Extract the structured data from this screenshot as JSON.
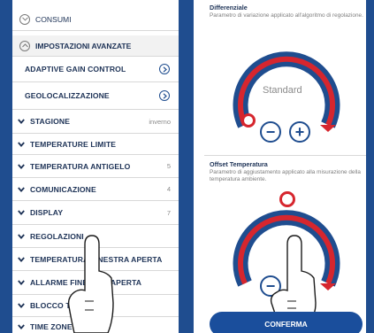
{
  "left": {
    "section_consumi": "CONSUMI",
    "section_advanced": "IMPOSTAZIONI AVANZATE",
    "items": [
      {
        "label": "ADAPTIVE GAIN CONTROL",
        "value": "",
        "kind": "link"
      },
      {
        "label": "GEOLOCALIZZAZIONE",
        "value": "",
        "kind": "link"
      },
      {
        "label": "STAGIONE",
        "value": "inverno",
        "kind": "expand"
      },
      {
        "label": "TEMPERATURE LIMITE",
        "value": "",
        "kind": "expand"
      },
      {
        "label": "TEMPERATURA ANTIGELO",
        "value": "5",
        "kind": "expand"
      },
      {
        "label": "COMUNICAZIONE",
        "value": "4",
        "kind": "expand"
      },
      {
        "label": "DISPLAY",
        "value": "7",
        "kind": "expand"
      },
      {
        "label": "REGOLAZIONI",
        "value": "",
        "kind": "expand"
      },
      {
        "label": "TEMPERATURA FINESTRA APERTA",
        "value": "",
        "kind": "expand"
      },
      {
        "label": "ALLARME FINESTRA APERTA",
        "value": "",
        "kind": "expand"
      },
      {
        "label": "BLOCCO TASTI",
        "value": "",
        "kind": "expand"
      },
      {
        "label": "TIME ZONE",
        "value": "",
        "kind": "expand"
      }
    ]
  },
  "right": {
    "differenziale": {
      "title": "Differenziale",
      "desc": "Parametro di variazione applicato all'algoritmo di regolazione.",
      "value_label": "Standard",
      "minus": "−",
      "plus": "+"
    },
    "offset": {
      "title": "Offset Temperatura",
      "desc": "Parametro di aggiustamento applicato alla misurazione della temperatura ambiente.",
      "minus": "−",
      "plus": "+"
    },
    "confirm_label": "CONFERMA"
  },
  "colors": {
    "brand_blue": "#1f4d8f",
    "arc_red": "#d6262e",
    "text_dark": "#1d3256"
  }
}
